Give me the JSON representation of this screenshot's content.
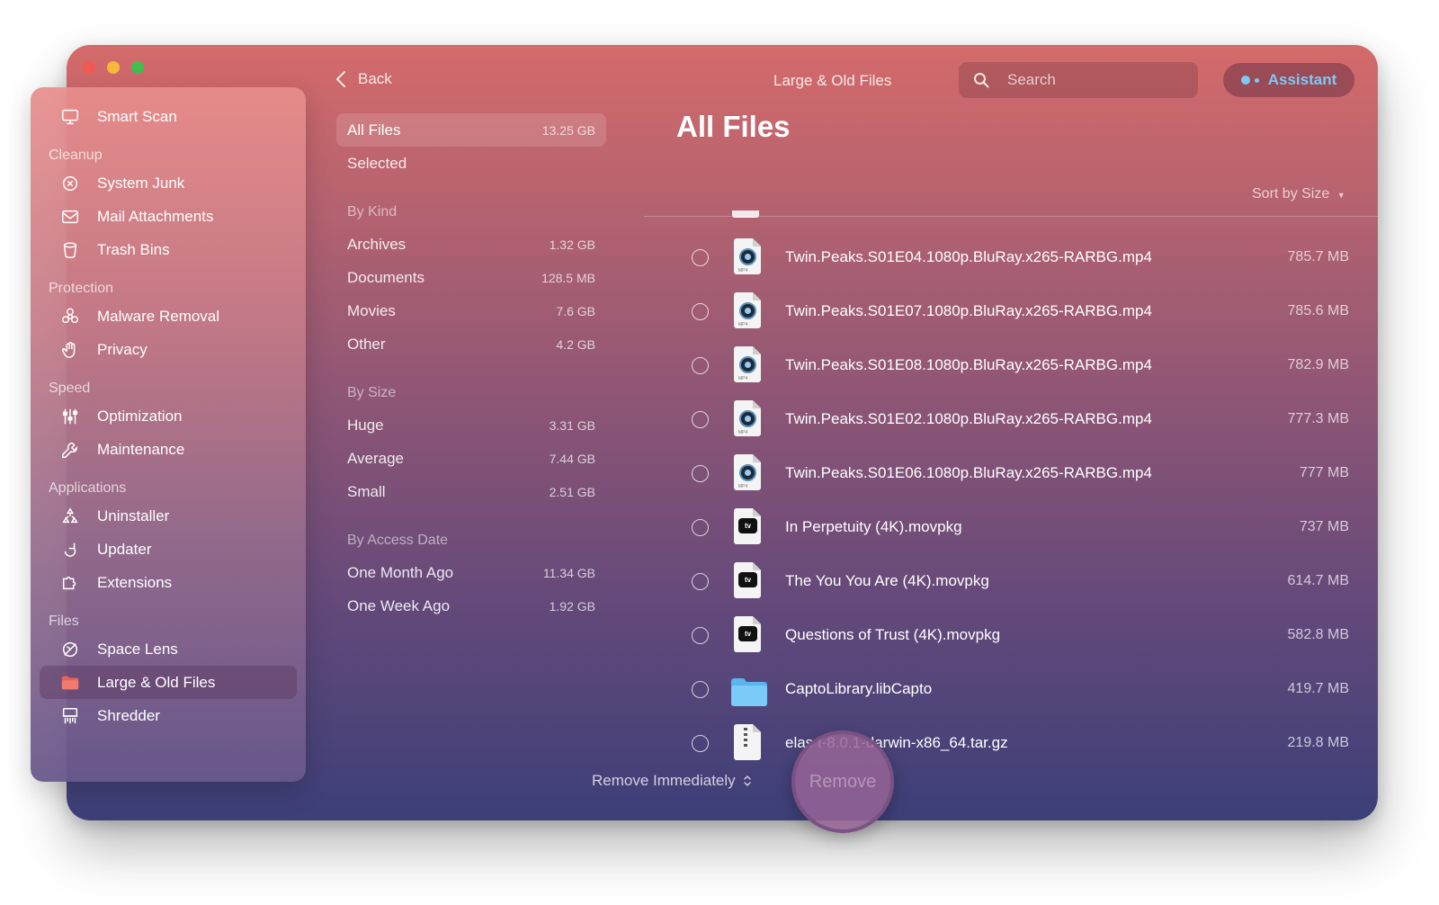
{
  "window": {
    "title": "Large & Old Files"
  },
  "nav": {
    "back_label": "Back"
  },
  "search": {
    "placeholder": "Search"
  },
  "assistant": {
    "label": "Assistant"
  },
  "sidebar": {
    "items": [
      {
        "type": "item",
        "label": "Smart Scan",
        "icon": "smart-scan-icon"
      },
      {
        "type": "section",
        "label": "Cleanup"
      },
      {
        "type": "item",
        "label": "System Junk",
        "icon": "system-junk-icon"
      },
      {
        "type": "item",
        "label": "Mail Attachments",
        "icon": "mail-icon"
      },
      {
        "type": "item",
        "label": "Trash Bins",
        "icon": "trash-icon"
      },
      {
        "type": "section",
        "label": "Protection"
      },
      {
        "type": "item",
        "label": "Malware Removal",
        "icon": "biohazard-icon"
      },
      {
        "type": "item",
        "label": "Privacy",
        "icon": "hand-icon"
      },
      {
        "type": "section",
        "label": "Speed"
      },
      {
        "type": "item",
        "label": "Optimization",
        "icon": "sliders-icon"
      },
      {
        "type": "item",
        "label": "Maintenance",
        "icon": "wrench-icon"
      },
      {
        "type": "section",
        "label": "Applications"
      },
      {
        "type": "item",
        "label": "Uninstaller",
        "icon": "uninstaller-icon"
      },
      {
        "type": "item",
        "label": "Updater",
        "icon": "updater-icon"
      },
      {
        "type": "item",
        "label": "Extensions",
        "icon": "extensions-icon"
      },
      {
        "type": "section",
        "label": "Files"
      },
      {
        "type": "item",
        "label": "Space Lens",
        "icon": "space-lens-icon"
      },
      {
        "type": "item",
        "label": "Large & Old Files",
        "icon": "folder-icon",
        "active": true
      },
      {
        "type": "item",
        "label": "Shredder",
        "icon": "shredder-icon"
      }
    ]
  },
  "filters": {
    "all_files": {
      "label": "All Files",
      "value": "13.25 GB"
    },
    "selected": {
      "label": "Selected"
    },
    "by_kind": {
      "title": "By Kind",
      "items": [
        {
          "label": "Archives",
          "value": "1.32 GB"
        },
        {
          "label": "Documents",
          "value": "128.5 MB"
        },
        {
          "label": "Movies",
          "value": "7.6 GB"
        },
        {
          "label": "Other",
          "value": "4.2 GB"
        }
      ]
    },
    "by_size": {
      "title": "By Size",
      "items": [
        {
          "label": "Huge",
          "value": "3.31 GB"
        },
        {
          "label": "Average",
          "value": "7.44 GB"
        },
        {
          "label": "Small",
          "value": "2.51 GB"
        }
      ]
    },
    "by_access": {
      "title": "By Access Date",
      "items": [
        {
          "label": "One Month Ago",
          "value": "11.34 GB"
        },
        {
          "label": "One Week Ago",
          "value": "1.92 GB"
        }
      ]
    }
  },
  "main": {
    "title": "All Files",
    "sort_label": "Sort by Size",
    "files": [
      {
        "name": "Twin.Peaks.S01E04.1080p.BluRay.x265-RARBG.mp4",
        "size": "785.7 MB",
        "kind": "mp4"
      },
      {
        "name": "Twin.Peaks.S01E07.1080p.BluRay.x265-RARBG.mp4",
        "size": "785.6 MB",
        "kind": "mp4"
      },
      {
        "name": "Twin.Peaks.S01E08.1080p.BluRay.x265-RARBG.mp4",
        "size": "782.9 MB",
        "kind": "mp4"
      },
      {
        "name": "Twin.Peaks.S01E02.1080p.BluRay.x265-RARBG.mp4",
        "size": "777.3 MB",
        "kind": "mp4"
      },
      {
        "name": "Twin.Peaks.S01E06.1080p.BluRay.x265-RARBG.mp4",
        "size": "777 MB",
        "kind": "mp4"
      },
      {
        "name": "In Perpetuity (4K).movpkg",
        "size": "737 MB",
        "kind": "movpkg"
      },
      {
        "name": "The You You Are (4K).movpkg",
        "size": "614.7 MB",
        "kind": "movpkg"
      },
      {
        "name": "Questions of Trust (4K).movpkg",
        "size": "582.8 MB",
        "kind": "movpkg"
      },
      {
        "name": "CaptoLibrary.libCapto",
        "size": "419.7 MB",
        "kind": "folder"
      },
      {
        "name": "elas        t-8.0.1-darwin-x86_64.tar.gz",
        "size": "219.8 MB",
        "kind": "archive"
      }
    ]
  },
  "bottom": {
    "remove_mode": "Remove Immediately",
    "remove_button": "Remove"
  },
  "colors": {
    "accent": "#7fc8f5",
    "active_folder": "#e8645a"
  }
}
